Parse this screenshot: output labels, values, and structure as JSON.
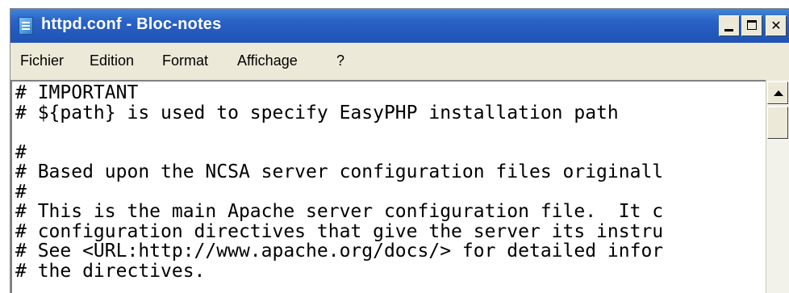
{
  "window": {
    "title": "httpd.conf - Bloc-notes",
    "icon": "notepad-icon",
    "controls": {
      "minimize": "minimize-icon",
      "maximize": "maximize-icon",
      "close": "close-icon"
    }
  },
  "menu": {
    "items": [
      {
        "label": "Fichier"
      },
      {
        "label": "Edition"
      },
      {
        "label": "Format"
      },
      {
        "label": "Affichage"
      },
      {
        "label": "?"
      }
    ]
  },
  "editor": {
    "lines": [
      "# IMPORTANT",
      "# ${path} is used to specify EasyPHP installation path",
      "",
      "#",
      "# Based upon the NCSA server configuration files originall",
      "#",
      "# This is the main Apache server configuration file.  It c",
      "# configuration directives that give the server its instru",
      "# See <URL:http://www.apache.org/docs/> for detailed infor",
      "# the directives."
    ]
  },
  "colors": {
    "titlebar": "#2a62c6",
    "chrome": "#ece9d8",
    "editor_bg": "#ffffff"
  }
}
